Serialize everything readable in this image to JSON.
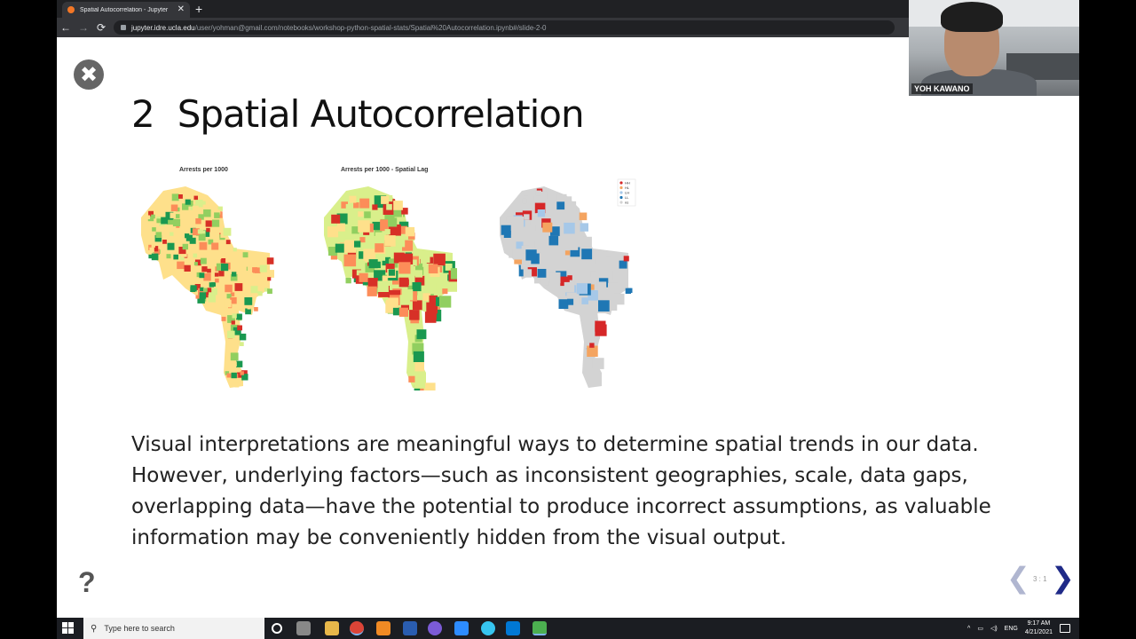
{
  "browser": {
    "tab_title": "Spatial Autocorrelation - Jupyter",
    "url_domain": "jupyter.idre.ucla.edu",
    "url_path": "/user/yohman@gmail.com/notebooks/workshop-python-spatial-stats/Spatial%20Autocorrelation.ipynb#/slide-2-0",
    "close_tab_glyph": "✕",
    "new_tab_glyph": "+",
    "back_glyph": "←",
    "forward_glyph": "→",
    "reload_glyph": "⟳"
  },
  "slide": {
    "close_glyph": "✖",
    "section_number": "2",
    "title": "Spatial Autocorrelation",
    "maps": [
      {
        "title": "Arrests per 1000"
      },
      {
        "title": "Arrests per 1000 - Spatial Lag"
      },
      {
        "title": ""
      }
    ],
    "lisa_legend": [
      "HH",
      "HL",
      "LH",
      "LL",
      "ns"
    ],
    "body_text": "Visual interpretations are meaningful ways to determine spatial trends in our data. However, underlying factors—such as inconsistent geographies, scale, data gaps, overlapping data—have the potential to produce incorrect assumptions, as valuable information may be conveniently hidden from the visual output.",
    "help_glyph": "?",
    "prev_glyph": "❮",
    "next_glyph": "❯",
    "slide_number": "3 : 1"
  },
  "webcam": {
    "name": "YOH KAWANO"
  },
  "taskbar": {
    "search_placeholder": "Type here to search",
    "tray_lang": "ENG",
    "time": "9:17 AM",
    "date": "4/21/2021"
  },
  "colors": {
    "tab_bg": "#35363a",
    "screen_bg": "#ffffff",
    "next_arrow": "#1f2a88",
    "prev_arrow": "#b0b6d0",
    "choropleth": [
      "#1a9850",
      "#91cf60",
      "#d9ef8b",
      "#fee08b",
      "#fc8d59",
      "#d73027"
    ],
    "lisa": {
      "HH": "#d62728",
      "HL": "#f4a460",
      "LH": "#a6c8e8",
      "LL": "#1f77b4",
      "ns": "#d3d3d3"
    }
  }
}
